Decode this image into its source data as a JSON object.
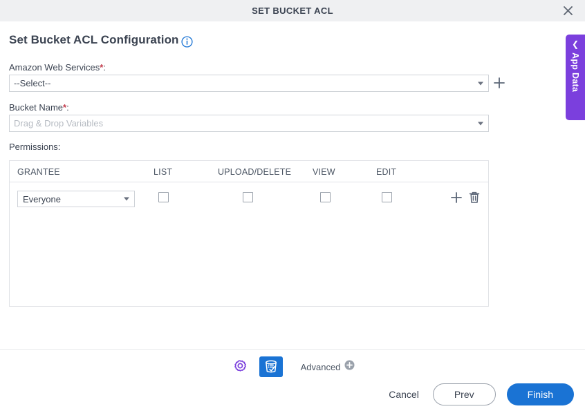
{
  "window": {
    "title": "SET BUCKET ACL",
    "close_icon": "close-icon"
  },
  "page": {
    "heading": "Set Bucket ACL Configuration",
    "info_icon": "info-icon"
  },
  "form": {
    "aws": {
      "label": "Amazon Web Services",
      "required_mark": "*",
      "colon": ":",
      "value": "--Select--",
      "add_icon": "plus-icon"
    },
    "bucket": {
      "label": "Bucket Name",
      "required_mark": "*",
      "colon": ":",
      "placeholder": "Drag & Drop Variables",
      "value": "Drag & Drop Variables"
    },
    "permissions": {
      "label": "Permissions",
      "colon": ":",
      "columns": [
        "GRANTEE",
        "LIST",
        "UPLOAD/DELETE",
        "VIEW",
        "EDIT"
      ],
      "rows": [
        {
          "grantee": "Everyone",
          "list": false,
          "upload_delete": false,
          "view": false,
          "edit": false,
          "add_icon": "plus-icon",
          "delete_icon": "trash-icon"
        }
      ]
    }
  },
  "footer": {
    "settings_icon": "gear-icon",
    "bucket_icon": "bucket-check-icon",
    "advanced_label": "Advanced",
    "advanced_icon": "plus-circle-icon",
    "cancel_label": "Cancel",
    "prev_label": "Prev",
    "finish_label": "Finish"
  },
  "side_panel": {
    "label": "App Data",
    "chevron_icon": "chevron-left-icon"
  },
  "colors": {
    "accent_blue": "#1a73d4",
    "purple": "#7b3fdd",
    "gear_purple": "#7b3fdd",
    "required_red": "#c23b4b",
    "titlebar_bg": "#eff0f2",
    "text": "#3b4351"
  }
}
